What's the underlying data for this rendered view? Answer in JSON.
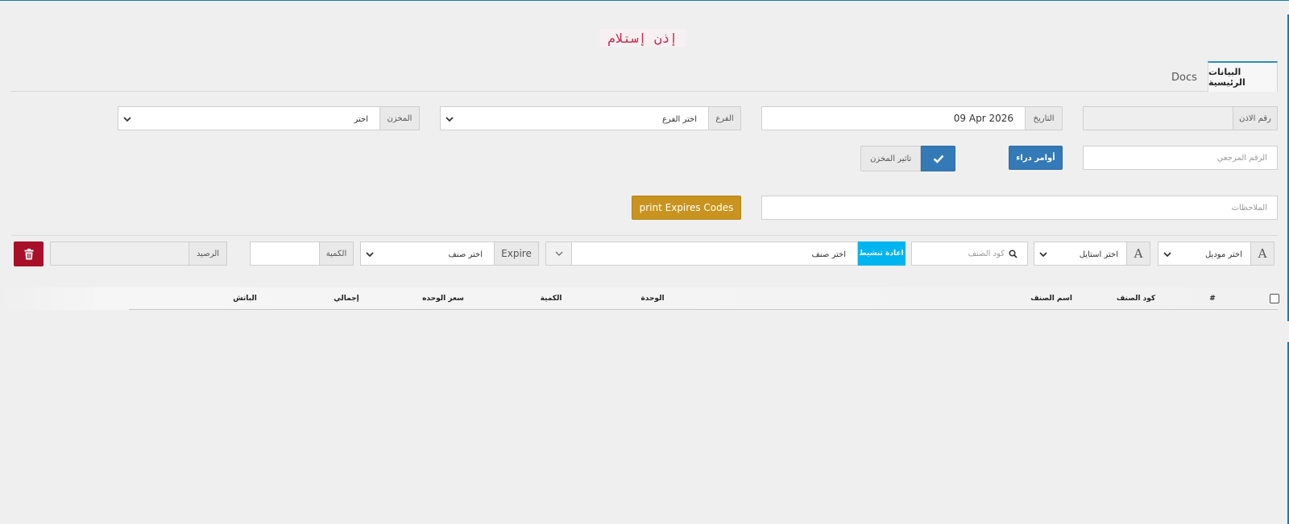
{
  "page": {
    "title": "إذن إستلام"
  },
  "tabs": [
    {
      "label": "البيانات الرئيسية",
      "active": true
    },
    {
      "label": "Docs",
      "active": false
    }
  ],
  "form": {
    "permit_no_label": "رقم الاذن",
    "date_label": "التاريخ",
    "date_value": "09 Apr 2026",
    "branch_label": "الفرع",
    "branch_value": "اختر الفرع",
    "warehouse_label": "المخزن",
    "warehouse_value": "اختر",
    "reference_placeholder": "الرقم المرجعي",
    "purchase_orders_button": "أوامر دراء",
    "warehouse_effect_label": "تاثير المخزن",
    "notes_placeholder": "الملاحظات",
    "print_button": "print Expires Codes"
  },
  "item_row": {
    "model_placeholder": "اختر موديل",
    "style_placeholder": "اختر استايل",
    "item_code_placeholder": "كود الصنف",
    "reactivate_button": "اعادة تنشيط",
    "item_select": "اختر صنف",
    "expire_label": "Expire",
    "expire_select": "اختر صنف",
    "quantity_label": "الكمية",
    "balance_label": "الرصيد"
  },
  "table": {
    "columns": [
      "#",
      "كود الصنف",
      "اسم الصنف",
      "الوحدة",
      "الكمية",
      "سعر الوحده",
      "إجمالي",
      "الباتش"
    ]
  },
  "colors": {
    "accent": "#2d8dbf",
    "title_text": "#c7254e",
    "primary_button": "#337ab7",
    "gold_button": "#c8941f",
    "cyan_button": "#00b4f0",
    "danger_button": "#a8102a"
  },
  "icons": [
    "check-icon",
    "search-icon",
    "trash-icon",
    "chevron-down-icon",
    "font-icon"
  ]
}
